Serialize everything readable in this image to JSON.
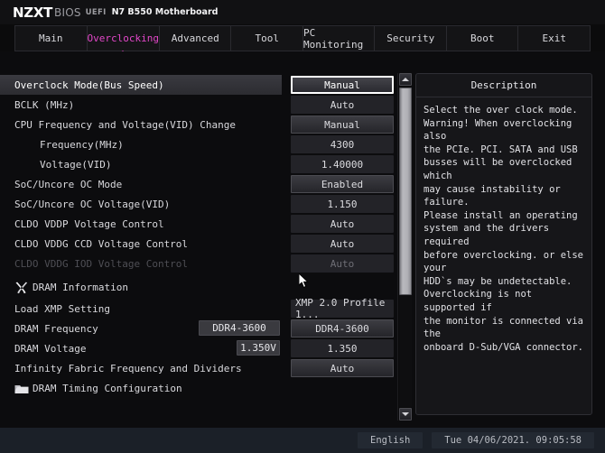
{
  "header": {
    "brand": "NZXT",
    "bios_label": "BIOS",
    "uefi_label": "UEFI",
    "board": "N7 B550 Motherboard"
  },
  "tabs": [
    {
      "label": "Main",
      "active": false
    },
    {
      "label": "Overclocking",
      "active": true
    },
    {
      "label": "Advanced",
      "active": false
    },
    {
      "label": "Tool",
      "active": false
    },
    {
      "label": "PC Monitoring",
      "active": false
    },
    {
      "label": "Security",
      "active": false
    },
    {
      "label": "Boot",
      "active": false
    },
    {
      "label": "Exit",
      "active": false
    }
  ],
  "accent_color": "#e247c8",
  "settings": [
    {
      "label": "Overclock Mode(Bus Speed)",
      "value": "Manual",
      "state": "selected",
      "box": "focused"
    },
    {
      "label": "BCLK (MHz)",
      "value": "Auto",
      "state": "normal",
      "box": "flat"
    },
    {
      "label": "CPU Frequency and Voltage(VID) Change",
      "value": "Manual",
      "state": "normal",
      "box": "raised"
    },
    {
      "label": "Frequency(MHz)",
      "value": "4300",
      "state": "normal",
      "box": "flat",
      "indent": true
    },
    {
      "label": "Voltage(VID)",
      "value": "1.40000",
      "state": "normal",
      "box": "flat",
      "indent": true
    },
    {
      "label": "SoC/Uncore OC Mode",
      "value": "Enabled",
      "state": "normal",
      "box": "raised"
    },
    {
      "label": "SoC/Uncore OC Voltage(VID)",
      "value": "1.150",
      "state": "normal",
      "box": "flat"
    },
    {
      "label": "CLDO VDDP Voltage Control",
      "value": "Auto",
      "state": "normal",
      "box": "flat"
    },
    {
      "label": "CLDO VDDG CCD Voltage Control",
      "value": "Auto",
      "state": "normal",
      "box": "flat"
    },
    {
      "label": "CLDO VDDG IOD Voltage Control",
      "value": "Auto",
      "state": "disabled",
      "box": "flat-dim"
    },
    {
      "label": "DRAM Information",
      "value": "",
      "state": "normal",
      "box": "none",
      "icon": "tools-icon"
    },
    {
      "label": "Load XMP Setting",
      "value": "XMP 2.0 Profile 1...",
      "state": "normal",
      "box": "flat-left"
    },
    {
      "label": "DRAM Frequency",
      "value": "DDR4-3600",
      "state": "normal",
      "box": "raised",
      "badge": "DDR4-3600"
    },
    {
      "label": "DRAM Voltage",
      "value": "1.350",
      "state": "normal",
      "box": "flat",
      "badge": "1.350V"
    },
    {
      "label": "Infinity Fabric Frequency and Dividers",
      "value": "Auto",
      "state": "normal",
      "box": "raised"
    },
    {
      "label": "DRAM Timing Configuration",
      "value": "",
      "state": "normal",
      "box": "none",
      "icon": "folder-icon"
    }
  ],
  "description": {
    "title": "Description",
    "text": "Select the over clock mode.\nWarning! When overclocking also\nthe PCIe. PCI. SATA and USB\nbusses will be overclocked which\nmay cause instability or failure.\nPlease install an operating\nsystem and the drivers required\nbefore overclocking. or else your\nHDD`s may be undetectable.\nOverclocking is not supported if\nthe monitor is connected via the\nonboard D-Sub/VGA connector."
  },
  "footer": {
    "language": "English",
    "datetime": "Tue 04/06/2021. 09:05:58"
  },
  "scrollbar": {
    "up_arrow": "scroll-up-arrow",
    "down_arrow": "scroll-down-arrow"
  }
}
